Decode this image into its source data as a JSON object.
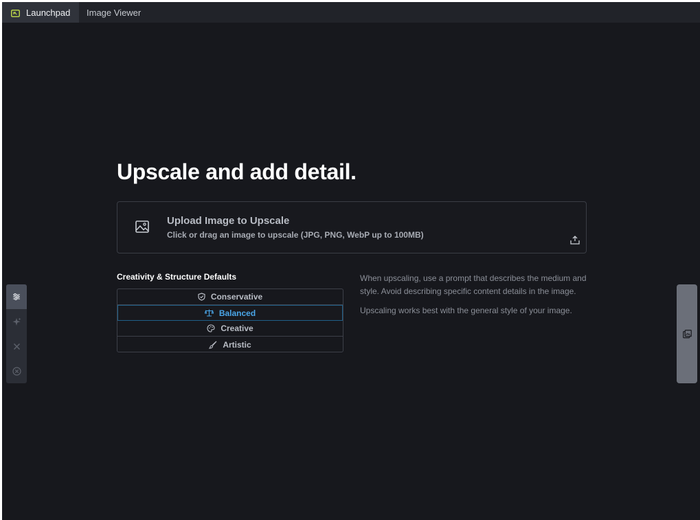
{
  "tabs": [
    {
      "label": "Launchpad",
      "icon": "launchpad-icon",
      "active": true
    },
    {
      "label": "Image Viewer",
      "active": false
    }
  ],
  "main": {
    "headline": "Upscale and add detail.",
    "upload": {
      "title": "Upload Image to Upscale",
      "subtitle": "Click or drag an image to upscale (JPG, PNG, WebP up to 100MB)"
    },
    "defaults_label": "Creativity & Structure Defaults",
    "options": [
      {
        "label": "Conservative",
        "icon": "shield-icon"
      },
      {
        "label": "Balanced",
        "icon": "scale-icon",
        "selected": true
      },
      {
        "label": "Creative",
        "icon": "palette-icon"
      },
      {
        "label": "Artistic",
        "icon": "brush-icon"
      }
    ],
    "help": [
      "When upscaling, use a prompt that describes the medium and style. Avoid describing specific content details in the image.",
      "Upscaling works best with the general style of your image."
    ]
  },
  "colors": {
    "background": "#17181d",
    "accent": "#4aa6e8",
    "tab_icon": "#b7d14a"
  }
}
